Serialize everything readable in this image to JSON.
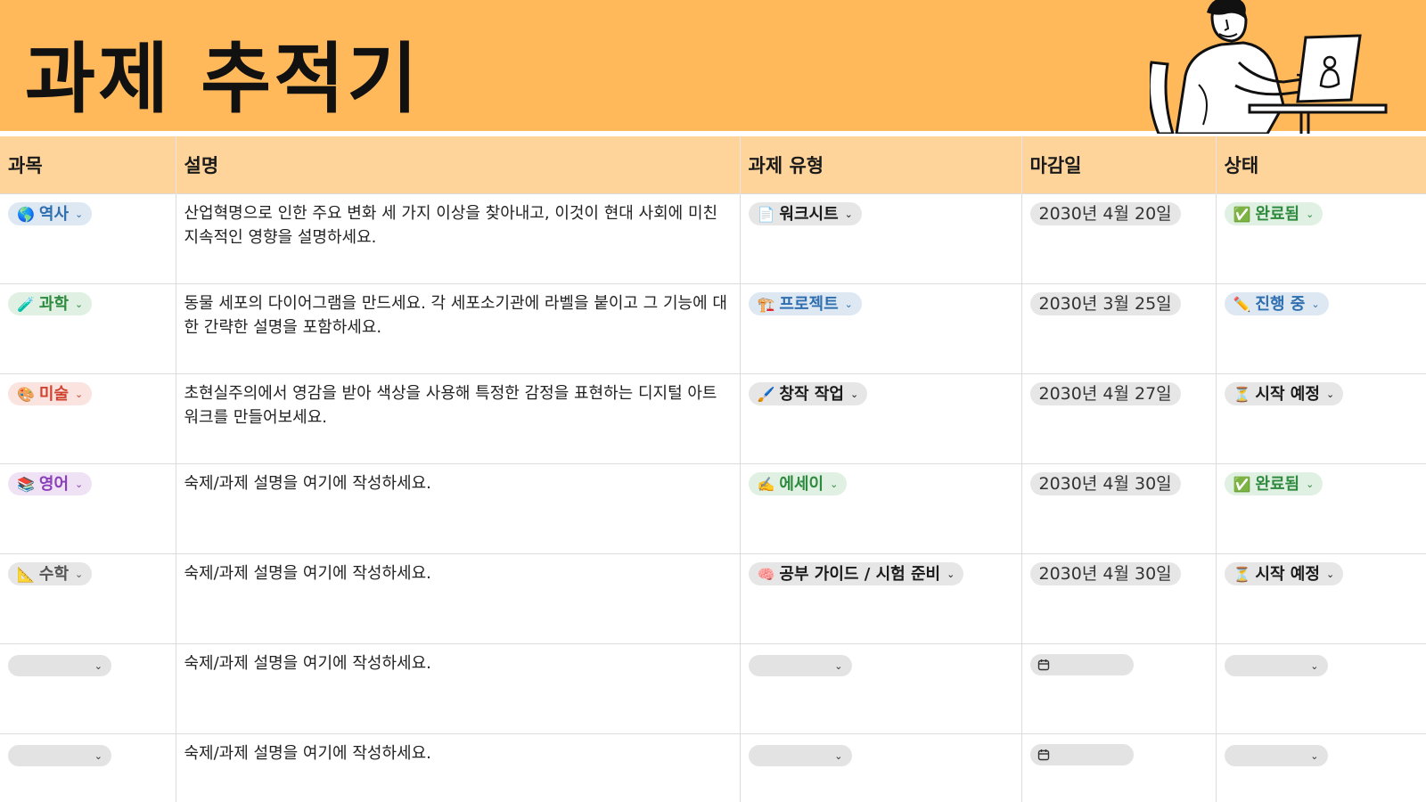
{
  "header": {
    "title": "과제 추적기"
  },
  "table": {
    "columns": [
      "과목",
      "설명",
      "과제 유형",
      "마감일",
      "상태"
    ],
    "rows": [
      {
        "subject": {
          "icon": "🌎",
          "label": "역사",
          "color": "#2f6fb0",
          "bg": "#dde8f3"
        },
        "description": "산업혁명으로 인한 주요 변화 세 가지 이상을 찾아내고, 이것이 현대 사회에 미친 지속적인 영향을 설명하세요.",
        "type": {
          "icon": "📄",
          "label": "워크시트",
          "color": "#1a1a1a",
          "bg": "#e6e6e6"
        },
        "due": "2030년 4월 20일",
        "status": {
          "icon": "✅",
          "label": "완료됨",
          "color": "#2e8a3e",
          "bg": "#e0f0e2"
        }
      },
      {
        "subject": {
          "icon": "🧪",
          "label": "과학",
          "color": "#2e8a3e",
          "bg": "#e0f0e2"
        },
        "description": "동물 세포의 다이어그램을 만드세요. 각 세포소기관에 라벨을 붙이고 그 기능에 대한 간략한 설명을 포함하세요.",
        "type": {
          "icon": "🏗️",
          "label": "프로젝트",
          "color": "#2f6fb0",
          "bg": "#dde8f3"
        },
        "due": "2030년 3월 25일",
        "status": {
          "icon": "✏️",
          "label": "진행 중",
          "color": "#2f6fb0",
          "bg": "#dde8f3"
        }
      },
      {
        "subject": {
          "icon": "🎨",
          "label": "미술",
          "color": "#d0412e",
          "bg": "#fbe3df"
        },
        "description": "초현실주의에서 영감을 받아 색상을 사용해 특정한 감정을 표현하는 디지털 아트워크를 만들어보세요.",
        "type": {
          "icon": "🖌️",
          "label": "창작 작업",
          "color": "#1a1a1a",
          "bg": "#e6e6e6"
        },
        "due": "2030년 4월 27일",
        "status": {
          "icon": "⏳",
          "label": "시작 예정",
          "color": "#1a1a1a",
          "bg": "#e6e6e6"
        }
      },
      {
        "subject": {
          "icon": "📚",
          "label": "영어",
          "color": "#8a3fb8",
          "bg": "#efe2f5"
        },
        "description": "숙제/과제 설명을 여기에 작성하세요.",
        "type": {
          "icon": "✍️",
          "label": "에세이",
          "color": "#2e8a3e",
          "bg": "#e0f0e2"
        },
        "due": "2030년 4월 30일",
        "status": {
          "icon": "✅",
          "label": "완료됨",
          "color": "#2e8a3e",
          "bg": "#e0f0e2"
        }
      },
      {
        "subject": {
          "icon": "📐",
          "label": "수학",
          "color": "#555555",
          "bg": "#e6e6e6"
        },
        "description": "숙제/과제 설명을 여기에 작성하세요.",
        "type": {
          "icon": "🧠",
          "label": "공부 가이드 / 시험 준비",
          "color": "#1a1a1a",
          "bg": "#e6e6e6"
        },
        "due": "2030년 4월 30일",
        "status": {
          "icon": "⏳",
          "label": "시작 예정",
          "color": "#1a1a1a",
          "bg": "#e6e6e6"
        }
      },
      {
        "subject": null,
        "description": "숙제/과제 설명을 여기에 작성하세요.",
        "type": null,
        "due": null,
        "status": null
      },
      {
        "subject": null,
        "description": "숙제/과제 설명을 여기에 작성하세요.",
        "type": null,
        "due": null,
        "status": null
      }
    ]
  },
  "icons": {
    "chevron": "⌄",
    "calendar": "calendar-icon"
  }
}
